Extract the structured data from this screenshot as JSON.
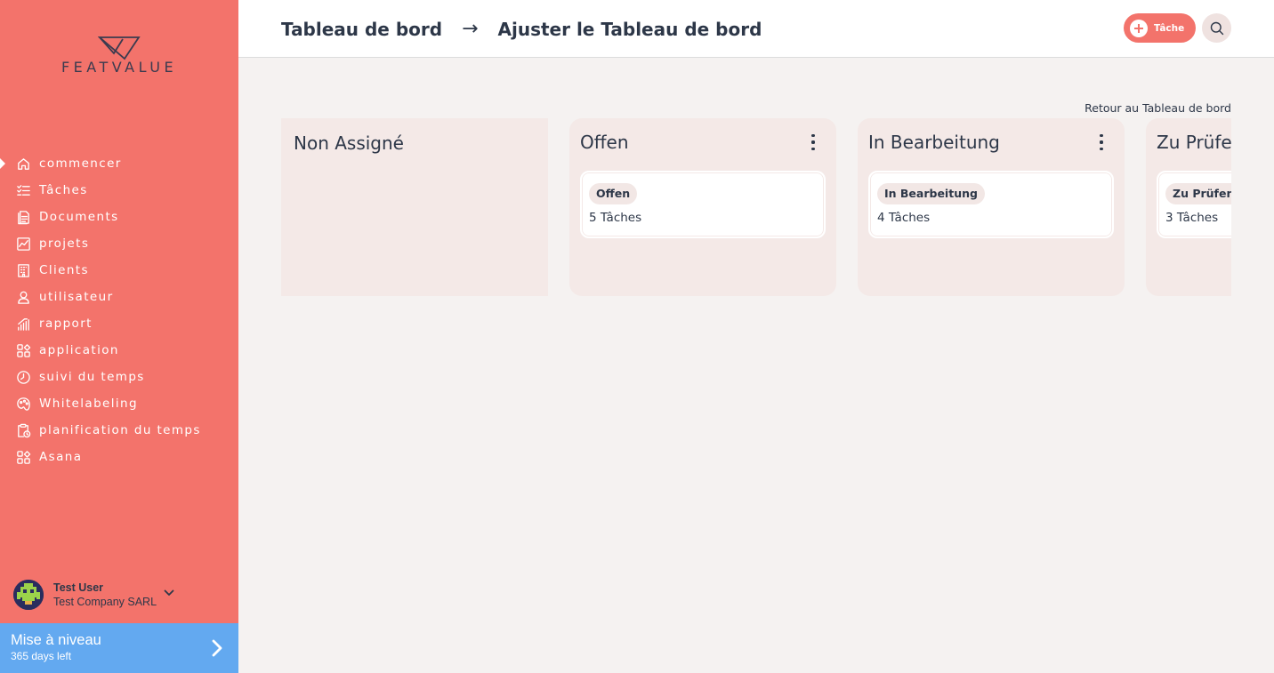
{
  "sidebar": {
    "logo_text": "FEATVALUE",
    "nav": [
      {
        "label": "commencer",
        "icon": "home-icon",
        "active": true
      },
      {
        "label": "Tâches",
        "icon": "task-list-icon"
      },
      {
        "label": "Documents",
        "icon": "document-icon"
      },
      {
        "label": "projets",
        "icon": "project-chart-icon"
      },
      {
        "label": "Clients",
        "icon": "building-icon"
      },
      {
        "label": "utilisateur",
        "icon": "user-icon"
      },
      {
        "label": "rapport",
        "icon": "report-bars-icon"
      },
      {
        "label": "application",
        "icon": "apps-grid-icon"
      },
      {
        "label": "suivi du temps",
        "icon": "timer-icon"
      },
      {
        "label": "Whitelabeling",
        "icon": "palette-icon"
      },
      {
        "label": "planification du temps",
        "icon": "clipboard-clock-icon"
      },
      {
        "label": "Asana",
        "icon": "apps-grid-icon"
      }
    ],
    "user": {
      "name": "Test User",
      "company": "Test Company SARL"
    },
    "upgrade": {
      "title": "Mise à niveau",
      "subtitle": "365 days left"
    }
  },
  "header": {
    "breadcrumb": [
      "Tableau de bord",
      "Ajuster le Tableau de bord"
    ],
    "separator": "→",
    "task_button": "Tâche"
  },
  "main": {
    "back_link": "Retour au Tableau de bord",
    "columns": [
      {
        "title": "Non Assigné"
      },
      {
        "title": "Offen",
        "card": {
          "status": "Offen",
          "count": "5 Tâches"
        }
      },
      {
        "title": "In Bearbeitung",
        "card": {
          "status": "In Bearbeitung",
          "count": "4 Tâches"
        }
      },
      {
        "title": "Zu Prüfen",
        "card": {
          "status": "Zu Prüfen",
          "count": "3 Tâches"
        }
      }
    ]
  },
  "colors": {
    "sidebar": "#f3736b",
    "upgrade": "#63a9f0",
    "background": "#f5f2f1",
    "column": "#f4e9e7",
    "text": "#2d3748"
  }
}
